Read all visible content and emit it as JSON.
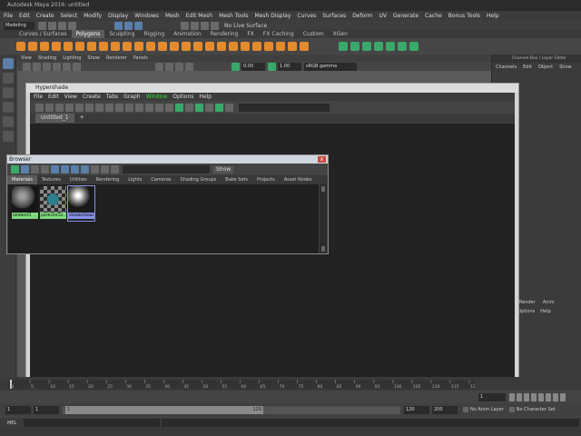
{
  "window": {
    "title": "Autodesk Maya 2016: untitled"
  },
  "menubar": [
    "File",
    "Edit",
    "Create",
    "Select",
    "Modify",
    "Display",
    "Windows",
    "Mesh",
    "Edit Mesh",
    "Mesh Tools",
    "Mesh Display",
    "Curves",
    "Surfaces",
    "Deform",
    "UV",
    "Generate",
    "Cache",
    "Bonus Tools",
    "Help"
  ],
  "statusline": {
    "mode": "Modeling",
    "live_surface": "No Live Surface"
  },
  "shelf": {
    "tabs": [
      "Curves / Surfaces",
      "Polygons",
      "Sculpting",
      "Rigging",
      "Animation",
      "Rendering",
      "FX",
      "FX Caching",
      "Custom",
      "XGen"
    ],
    "active_tab": "Polygons"
  },
  "viewport": {
    "menu": [
      "View",
      "Shading",
      "Lighting",
      "Show",
      "Renderer",
      "Panels"
    ],
    "field1": "0.00",
    "field2": "1.00",
    "colorspace": "sRGB gamma"
  },
  "right_panel": {
    "header": "Channel Box / Layer Editor",
    "menu": [
      "Channels",
      "Edit",
      "Object",
      "Show"
    ],
    "lower_tabs": [
      "Render",
      "Anim"
    ],
    "lower_menu": [
      "Options",
      "Help"
    ]
  },
  "hypershade": {
    "title": "Hypershade",
    "menu": [
      "File",
      "Edit",
      "View",
      "Create",
      "Tabs",
      "Graph",
      "Window",
      "Options",
      "Help"
    ],
    "highlight_menu": "Window",
    "tab": "Untitled_1",
    "add_tab": "+"
  },
  "browser": {
    "title": "Browser",
    "close": "x",
    "show_label": "Show",
    "tabs": [
      "Materials",
      "Textures",
      "Utilities",
      "Rendering",
      "Lights",
      "Cameras",
      "Shading Groups",
      "Bake Sets",
      "Projects",
      "Asset Nodes"
    ],
    "active_tab": "Materials",
    "swatches": [
      {
        "label": "lambert1",
        "label_color": "#7ed97e",
        "ball": "gray"
      },
      {
        "label": "particleClo...",
        "label_color": "#7ed97e",
        "ball": "checker"
      },
      {
        "label": "shaderGlow1",
        "label_color": "#8a93e8",
        "ball": "chrome"
      }
    ]
  },
  "timeline": {
    "ticks": [
      "1",
      "5",
      "10",
      "15",
      "20",
      "25",
      "30",
      "35",
      "40",
      "45",
      "50",
      "55",
      "60",
      "65",
      "70",
      "75",
      "80",
      "85",
      "90",
      "95",
      "100",
      "105",
      "110",
      "115",
      "120"
    ],
    "current_frame": "1",
    "start": "1",
    "range_start": "1",
    "range_label_start": "1",
    "range_label_end": "120",
    "end": "120",
    "anim_end": "200",
    "anim_layer": "No Anim Layer",
    "character_set": "No Character Set"
  },
  "cmdline": {
    "label": "MEL"
  }
}
